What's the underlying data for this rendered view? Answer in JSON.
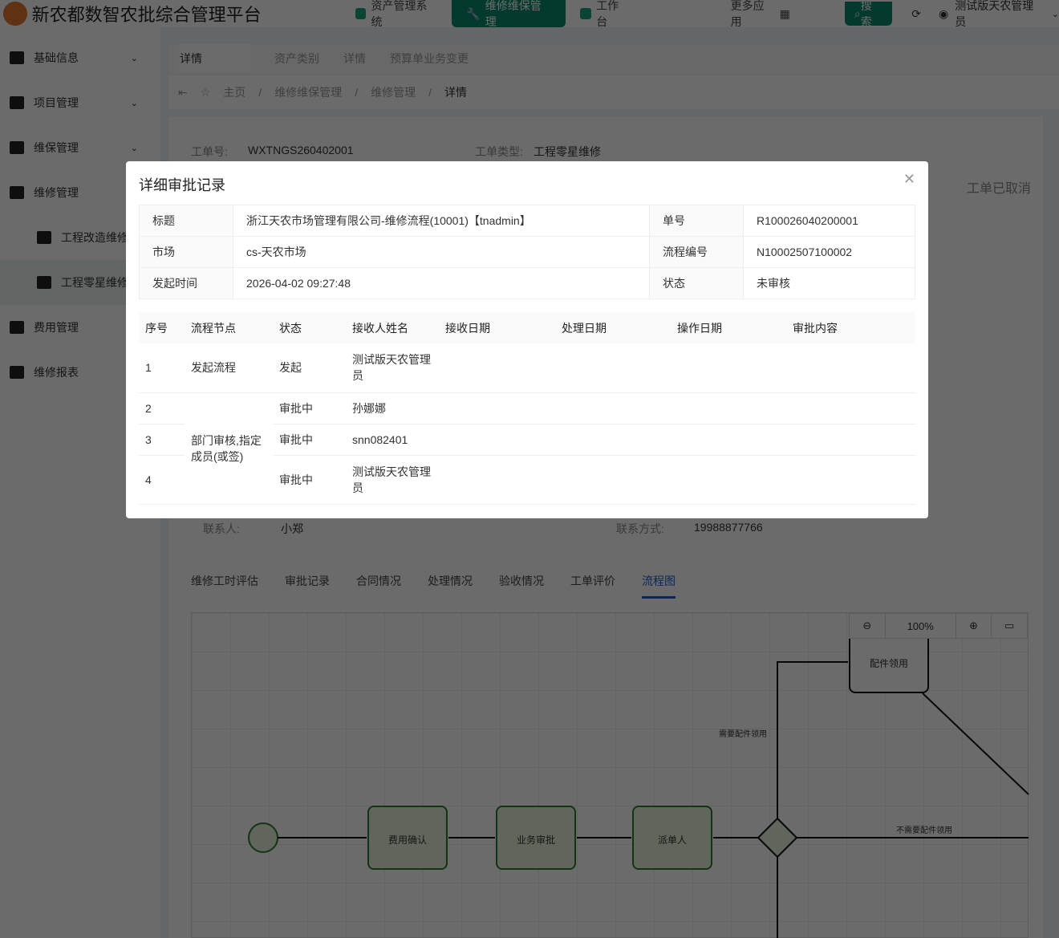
{
  "header": {
    "title": "新农都数智农批综合管理平台",
    "nav": [
      "资产管理系统",
      "维修维保管理",
      "工作台"
    ],
    "more": "更多应用",
    "search": "搜索",
    "user": "测试版天农管理员"
  },
  "sidebar": [
    "基础信息",
    "项目管理",
    "维保管理",
    "维修管理",
    "工程改造维修",
    "工程零星维修",
    "费用管理",
    "维修报表"
  ],
  "tabs": [
    "详情",
    "资产类别",
    "详情",
    "预算单业务变更"
  ],
  "breadcrumb": [
    "主页",
    "维修维保管理",
    "维修管理",
    "详情"
  ],
  "detail": {
    "order_no_label": "工单号:",
    "order_no": "WXTNGS260402001",
    "type_label": "工单类型:",
    "type": "工程零星维修",
    "status": "工单已取消",
    "contact_label": "联系人:",
    "contact": "小郑",
    "phone_label": "联系方式:",
    "phone": "19988877766"
  },
  "page_tabs": [
    "维修工时评估",
    "审批记录",
    "合同情况",
    "处理情况",
    "验收情况",
    "工单评价",
    "流程图"
  ],
  "diagram": {
    "zoom": "100%",
    "nodes": [
      "费用确认",
      "业务审批",
      "派单人",
      "配件领用"
    ],
    "edges": [
      "需要配件领用",
      "不需要配件领用"
    ]
  },
  "modal": {
    "title": "详细审批记录",
    "info": [
      [
        "标题",
        "浙江天农市场管理有限公司-维修流程(10001)【tnadmin】",
        "单号",
        "R100026040200001"
      ],
      [
        "市场",
        "cs-天农市场",
        "流程编号",
        "N10002507100002"
      ],
      [
        "发起时间",
        "2026-04-02 09:27:48",
        "状态",
        "未审核"
      ]
    ],
    "columns": [
      "序号",
      "流程节点",
      "状态",
      "接收人姓名",
      "接收日期",
      "处理日期",
      "操作日期",
      "审批内容"
    ],
    "rows": [
      {
        "no": "1",
        "node": "发起流程",
        "status": "发起",
        "receiver": "测试版天农管理员"
      },
      {
        "no": "2",
        "status": "审批中",
        "receiver": "孙娜娜"
      },
      {
        "no": "3",
        "status": "审批中",
        "receiver": "snn082401"
      },
      {
        "no": "4",
        "status": "审批中",
        "receiver": "测试版天农管理员"
      }
    ],
    "merged_node": "部门审核,指定成员(或签)"
  }
}
